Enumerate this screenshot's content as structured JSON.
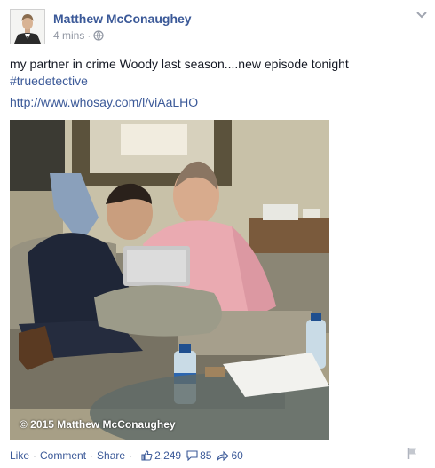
{
  "post": {
    "author": "Matthew McConaughey",
    "time": "4 mins",
    "text": "my partner in crime Woody last season....new episode tonight",
    "hashtag": "#truedetective",
    "link": "http://www.whosay.com/l/viAaLHO",
    "photo_credit": "© 2015 Matthew McConaughey"
  },
  "footer": {
    "like": "Like",
    "comment": "Comment",
    "share": "Share",
    "separator": "·",
    "likes_count": "2,249",
    "comments_count": "85",
    "shares_count": "60"
  },
  "icons": {
    "privacy": "globe-icon",
    "menu": "chevron-down-icon",
    "likes": "thumbs-up-icon",
    "comments": "comment-icon",
    "shares": "share-icon",
    "report": "flag-icon"
  },
  "colors": {
    "link": "#3b5998",
    "meta": "#9197a3",
    "text": "#141823"
  }
}
